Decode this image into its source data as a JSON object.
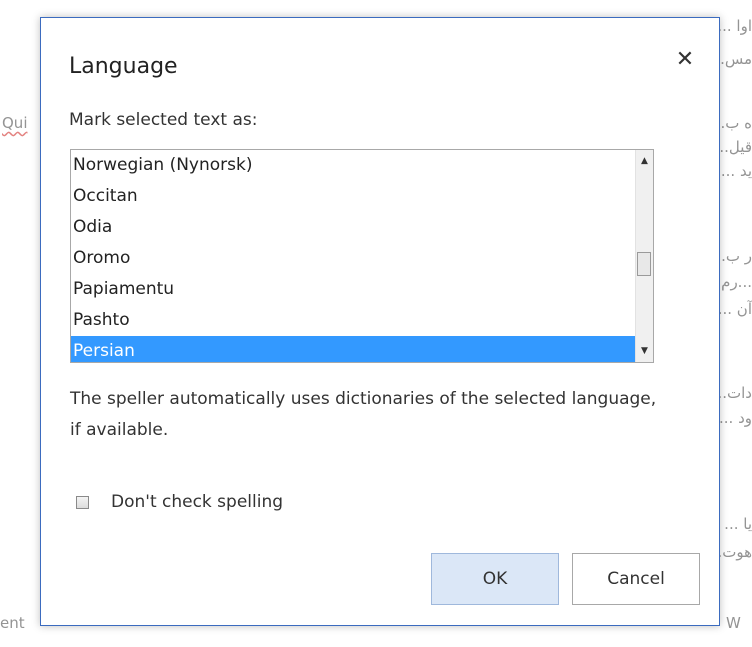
{
  "document": {
    "lines_right": [
      "اوا  ...ا Office... ا... دانلود برنامه Word ... کنید،",
      "مس... کنید؟",
      "ه ب...",
      "قیل...",
      "ید ...",
      "ر ب...",
      "...رم",
      "آن ...",
      "دات...",
      "ود ...",
      "یا ...",
      "هوت..."
    ],
    "fragments_left": {
      "qui": "Qui",
      "ent": "ent",
      "w": "W"
    }
  },
  "dialog": {
    "title": "Language",
    "close_glyph": "✕",
    "prompt": "Mark selected text as:",
    "languages": [
      "Norwegian (Nynorsk)",
      "Occitan",
      "Odia",
      "Oromo",
      "Papiamentu",
      "Pashto",
      "Persian"
    ],
    "selected_language": "Persian",
    "note": "The speller automatically uses dictionaries of the selected language, if available.",
    "checkbox_label": "Don't check spelling",
    "checkbox_checked": false,
    "ok_label": "OK",
    "cancel_label": "Cancel",
    "scroll_up_glyph": "▲",
    "scroll_down_glyph": "▼",
    "scroll_position": 0.55
  },
  "colors": {
    "selection": "#3399ff",
    "dialog_border": "#3b6bbf",
    "ok_button": "#dbe7f7"
  }
}
